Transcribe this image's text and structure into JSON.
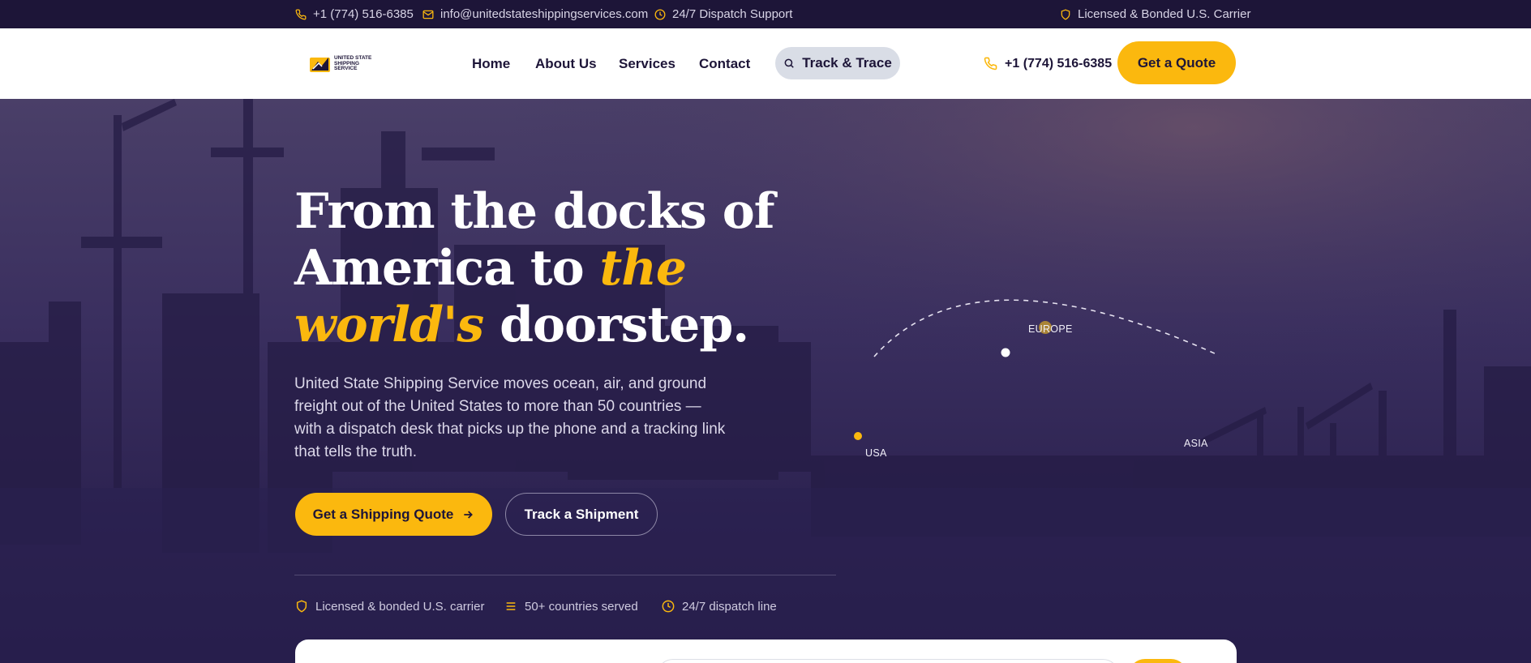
{
  "topbar": {
    "phone": "+1 (774) 516-6385",
    "email": "info@unitedstateshippingservices.com",
    "support": "24/7 Dispatch Support",
    "license": "Licensed & Bonded U.S. Carrier"
  },
  "logo": {
    "text": "United State Shipping Service"
  },
  "nav": {
    "links": [
      "Home",
      "About Us",
      "Services",
      "Contact"
    ],
    "track_label": "Track & Trace",
    "phone": "+1 (774) 516-6385",
    "quote_label": "Get a Quote"
  },
  "hero": {
    "title_part1": "From the docks of America to ",
    "title_highlight": "the world's",
    "title_part2": " doorstep.",
    "subtitle": "United State Shipping Service moves ocean, air, and ground freight out of the United States to more than 50 countries — with a dispatch desk that picks up the phone and a tracking link that tells the truth.",
    "cta_primary": "Get a Shipping Quote",
    "cta_secondary": "Track a Shipment",
    "trust": [
      "Licensed & bonded U.S. carrier",
      "50+ countries served",
      "24/7 dispatch line"
    ]
  },
  "map": {
    "labels": [
      "EUROPE",
      "USA",
      "ASIA"
    ]
  },
  "colors": {
    "accent": "#fbb80e",
    "navy": "#1d1538",
    "hero_bg": "#2c2250"
  },
  "icons": {
    "phone": "phone-icon",
    "mail": "mail-icon",
    "clock": "clock-icon",
    "shield": "shield-icon",
    "search": "search-icon",
    "arrow": "arrow-right-icon",
    "list": "list-icon"
  }
}
